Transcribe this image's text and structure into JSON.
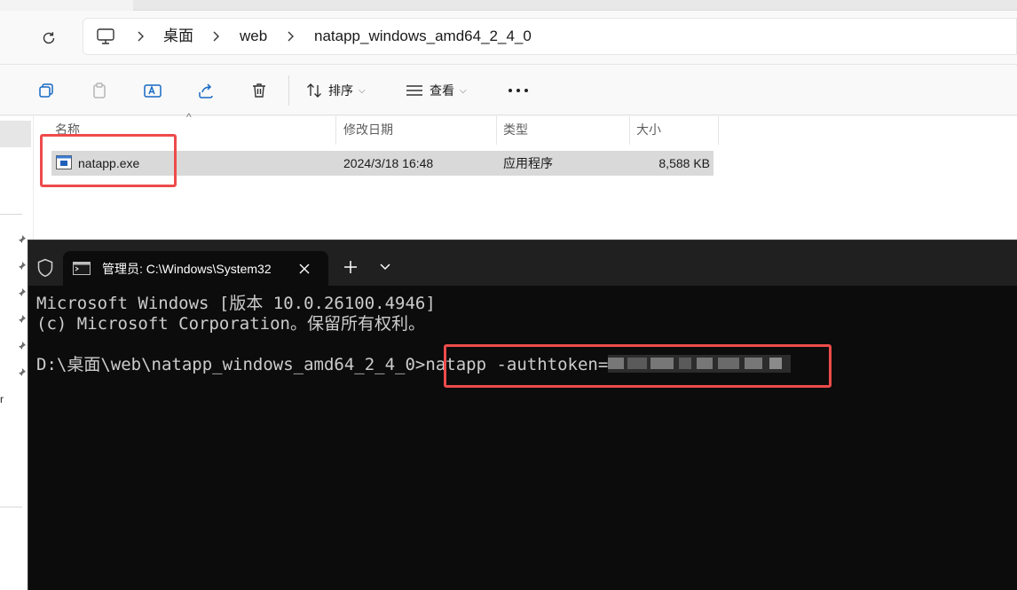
{
  "explorer": {
    "breadcrumb": [
      "桌面",
      "web",
      "natapp_windows_amd64_2_4_0"
    ],
    "toolbar": {
      "sort_label": "排序",
      "view_label": "查看"
    },
    "columns": {
      "name": "名称",
      "modified": "修改日期",
      "type": "类型",
      "size": "大小"
    },
    "files": [
      {
        "name": "natapp.exe",
        "modified": "2024/3/18 16:48",
        "type": "应用程序",
        "size": "8,588 KB"
      }
    ],
    "left_pane_text": "r"
  },
  "terminal": {
    "tab_title": "管理员: C:\\Windows\\System32",
    "lines": [
      "Microsoft Windows [版本 10.0.26100.4946]",
      "(c) Microsoft Corporation。保留所有权利。"
    ],
    "prompt": "D:\\桌面\\web\\natapp_windows_amd64_2_4_0>",
    "command": "natapp -authtoken="
  },
  "colors": {
    "highlight": "#ee4b4b",
    "terminal_bg": "#0c0c0c",
    "terminal_text": "#cccccc",
    "tabbar_bg": "#202020",
    "selected_row": "#d9d9d9"
  },
  "icons": [
    "computer-icon",
    "refresh-icon",
    "copy-icon",
    "paste-icon",
    "rename-icon",
    "share-icon",
    "delete-icon",
    "sort-icon",
    "view-icon",
    "more-icon",
    "exe-file-icon",
    "pin-icon",
    "shield-icon",
    "terminal-icon",
    "close-icon",
    "plus-icon",
    "chevron-down-icon"
  ]
}
